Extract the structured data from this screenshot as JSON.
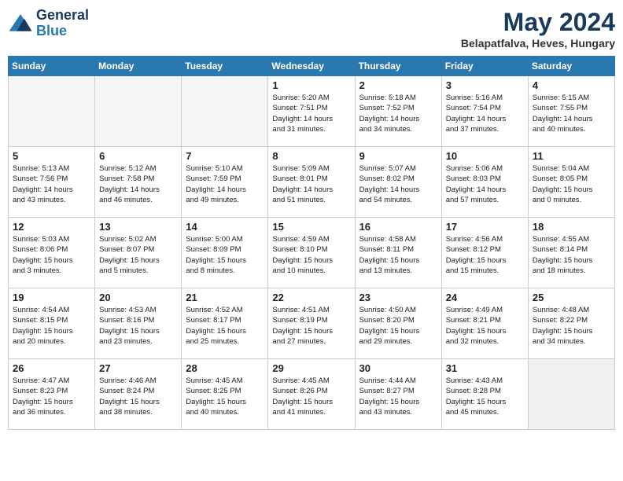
{
  "header": {
    "logo_line1": "General",
    "logo_line2": "Blue",
    "month": "May 2024",
    "location": "Belapatfalva, Heves, Hungary"
  },
  "weekdays": [
    "Sunday",
    "Monday",
    "Tuesday",
    "Wednesday",
    "Thursday",
    "Friday",
    "Saturday"
  ],
  "weeks": [
    [
      {
        "day": "",
        "content": ""
      },
      {
        "day": "",
        "content": ""
      },
      {
        "day": "",
        "content": ""
      },
      {
        "day": "1",
        "content": "Sunrise: 5:20 AM\nSunset: 7:51 PM\nDaylight: 14 hours\nand 31 minutes."
      },
      {
        "day": "2",
        "content": "Sunrise: 5:18 AM\nSunset: 7:52 PM\nDaylight: 14 hours\nand 34 minutes."
      },
      {
        "day": "3",
        "content": "Sunrise: 5:16 AM\nSunset: 7:54 PM\nDaylight: 14 hours\nand 37 minutes."
      },
      {
        "day": "4",
        "content": "Sunrise: 5:15 AM\nSunset: 7:55 PM\nDaylight: 14 hours\nand 40 minutes."
      }
    ],
    [
      {
        "day": "5",
        "content": "Sunrise: 5:13 AM\nSunset: 7:56 PM\nDaylight: 14 hours\nand 43 minutes."
      },
      {
        "day": "6",
        "content": "Sunrise: 5:12 AM\nSunset: 7:58 PM\nDaylight: 14 hours\nand 46 minutes."
      },
      {
        "day": "7",
        "content": "Sunrise: 5:10 AM\nSunset: 7:59 PM\nDaylight: 14 hours\nand 49 minutes."
      },
      {
        "day": "8",
        "content": "Sunrise: 5:09 AM\nSunset: 8:01 PM\nDaylight: 14 hours\nand 51 minutes."
      },
      {
        "day": "9",
        "content": "Sunrise: 5:07 AM\nSunset: 8:02 PM\nDaylight: 14 hours\nand 54 minutes."
      },
      {
        "day": "10",
        "content": "Sunrise: 5:06 AM\nSunset: 8:03 PM\nDaylight: 14 hours\nand 57 minutes."
      },
      {
        "day": "11",
        "content": "Sunrise: 5:04 AM\nSunset: 8:05 PM\nDaylight: 15 hours\nand 0 minutes."
      }
    ],
    [
      {
        "day": "12",
        "content": "Sunrise: 5:03 AM\nSunset: 8:06 PM\nDaylight: 15 hours\nand 3 minutes."
      },
      {
        "day": "13",
        "content": "Sunrise: 5:02 AM\nSunset: 8:07 PM\nDaylight: 15 hours\nand 5 minutes."
      },
      {
        "day": "14",
        "content": "Sunrise: 5:00 AM\nSunset: 8:09 PM\nDaylight: 15 hours\nand 8 minutes."
      },
      {
        "day": "15",
        "content": "Sunrise: 4:59 AM\nSunset: 8:10 PM\nDaylight: 15 hours\nand 10 minutes."
      },
      {
        "day": "16",
        "content": "Sunrise: 4:58 AM\nSunset: 8:11 PM\nDaylight: 15 hours\nand 13 minutes."
      },
      {
        "day": "17",
        "content": "Sunrise: 4:56 AM\nSunset: 8:12 PM\nDaylight: 15 hours\nand 15 minutes."
      },
      {
        "day": "18",
        "content": "Sunrise: 4:55 AM\nSunset: 8:14 PM\nDaylight: 15 hours\nand 18 minutes."
      }
    ],
    [
      {
        "day": "19",
        "content": "Sunrise: 4:54 AM\nSunset: 8:15 PM\nDaylight: 15 hours\nand 20 minutes."
      },
      {
        "day": "20",
        "content": "Sunrise: 4:53 AM\nSunset: 8:16 PM\nDaylight: 15 hours\nand 23 minutes."
      },
      {
        "day": "21",
        "content": "Sunrise: 4:52 AM\nSunset: 8:17 PM\nDaylight: 15 hours\nand 25 minutes."
      },
      {
        "day": "22",
        "content": "Sunrise: 4:51 AM\nSunset: 8:19 PM\nDaylight: 15 hours\nand 27 minutes."
      },
      {
        "day": "23",
        "content": "Sunrise: 4:50 AM\nSunset: 8:20 PM\nDaylight: 15 hours\nand 29 minutes."
      },
      {
        "day": "24",
        "content": "Sunrise: 4:49 AM\nSunset: 8:21 PM\nDaylight: 15 hours\nand 32 minutes."
      },
      {
        "day": "25",
        "content": "Sunrise: 4:48 AM\nSunset: 8:22 PM\nDaylight: 15 hours\nand 34 minutes."
      }
    ],
    [
      {
        "day": "26",
        "content": "Sunrise: 4:47 AM\nSunset: 8:23 PM\nDaylight: 15 hours\nand 36 minutes."
      },
      {
        "day": "27",
        "content": "Sunrise: 4:46 AM\nSunset: 8:24 PM\nDaylight: 15 hours\nand 38 minutes."
      },
      {
        "day": "28",
        "content": "Sunrise: 4:45 AM\nSunset: 8:25 PM\nDaylight: 15 hours\nand 40 minutes."
      },
      {
        "day": "29",
        "content": "Sunrise: 4:45 AM\nSunset: 8:26 PM\nDaylight: 15 hours\nand 41 minutes."
      },
      {
        "day": "30",
        "content": "Sunrise: 4:44 AM\nSunset: 8:27 PM\nDaylight: 15 hours\nand 43 minutes."
      },
      {
        "day": "31",
        "content": "Sunrise: 4:43 AM\nSunset: 8:28 PM\nDaylight: 15 hours\nand 45 minutes."
      },
      {
        "day": "",
        "content": ""
      }
    ]
  ]
}
